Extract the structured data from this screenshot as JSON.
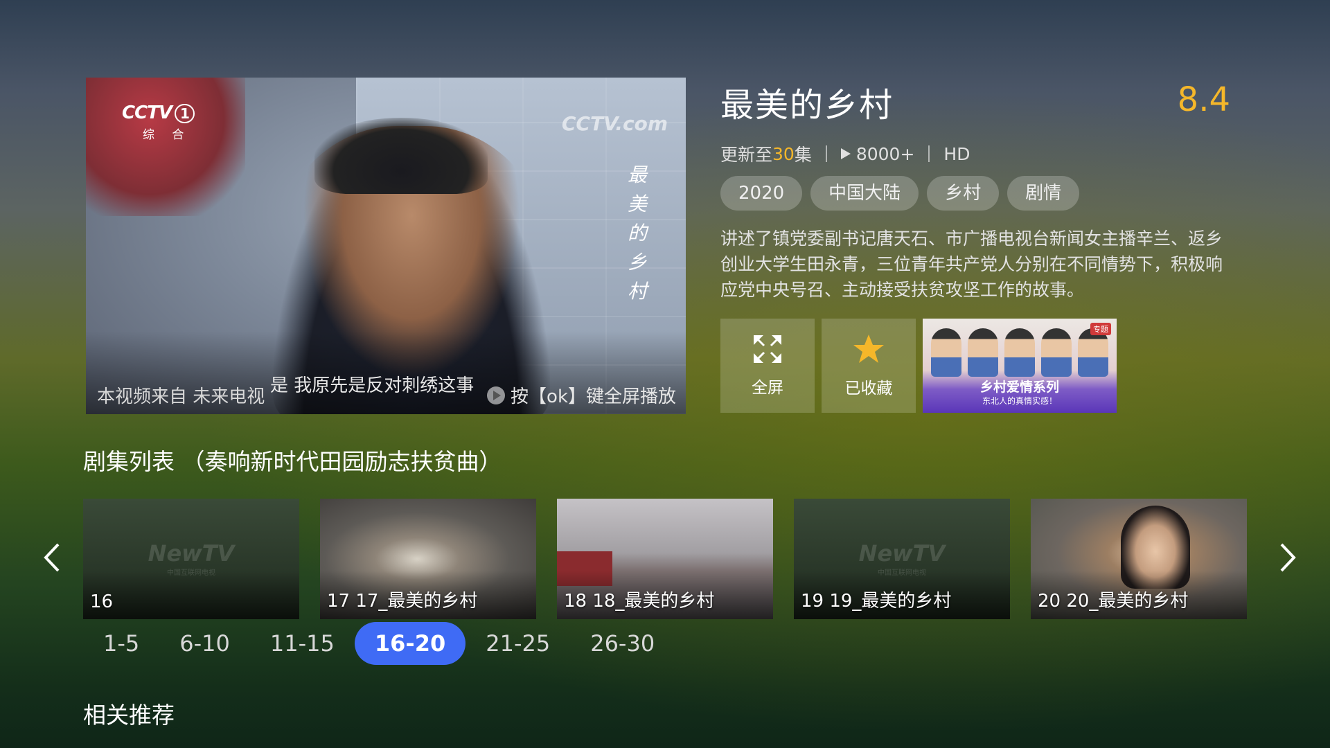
{
  "player": {
    "channel_logo": "CCTV",
    "channel_number": "1",
    "channel_sub": "综 合",
    "watermark": "CCTV.com",
    "vertical_title": [
      "最",
      "美",
      "的",
      "乡",
      "村"
    ],
    "source_text": "本视频来自 未来电视",
    "subtitle": "是  我原先是反对刺绣这事",
    "hint": "按【ok】键全屏播放"
  },
  "show": {
    "title": "最美的乡村",
    "rating": "8.4",
    "update_prefix": "更新至",
    "update_count": "30",
    "update_suffix": "集",
    "plays": "8000+",
    "quality": "HD",
    "tags": [
      "2020",
      "中国大陆",
      "乡村",
      "剧情"
    ],
    "description": "讲述了镇党委副书记唐天石、市广播电视台新闻女主播辛兰、返乡创业大学生田永青，三位青年共产党人分别在不同情势下，积极响应党中央号召、主动接受扶贫攻坚工作的故事。"
  },
  "actions": {
    "fullscreen_label": "全屏",
    "favorite_label": "已收藏",
    "promo_title": "乡村爱情系列",
    "promo_subtitle": "东北人的真情实感！",
    "promo_badge": "专题"
  },
  "episodes": {
    "section_title": "剧集列表 （奏响新时代田园励志扶贫曲）",
    "newtv_logo": "NewTV",
    "newtv_sub": "中国互联网电视",
    "items": [
      {
        "caption": "16"
      },
      {
        "caption": "17 17_最美的乡村"
      },
      {
        "caption": "18 18_最美的乡村"
      },
      {
        "caption": "19 19_最美的乡村"
      },
      {
        "caption": "20 20_最美的乡村"
      }
    ],
    "ranges": [
      "1-5",
      "6-10",
      "11-15",
      "16-20",
      "21-25",
      "26-30"
    ],
    "active_range": "16-20"
  },
  "related": {
    "section_title": "相关推荐"
  },
  "colors": {
    "accent_gold": "#f5b72a",
    "active_blue": "#3f6bf5"
  },
  "icons": [
    "fullscreen-icon",
    "star-icon",
    "chevron-left-icon",
    "chevron-right-icon",
    "play-circle-icon",
    "play-triangle-icon"
  ]
}
